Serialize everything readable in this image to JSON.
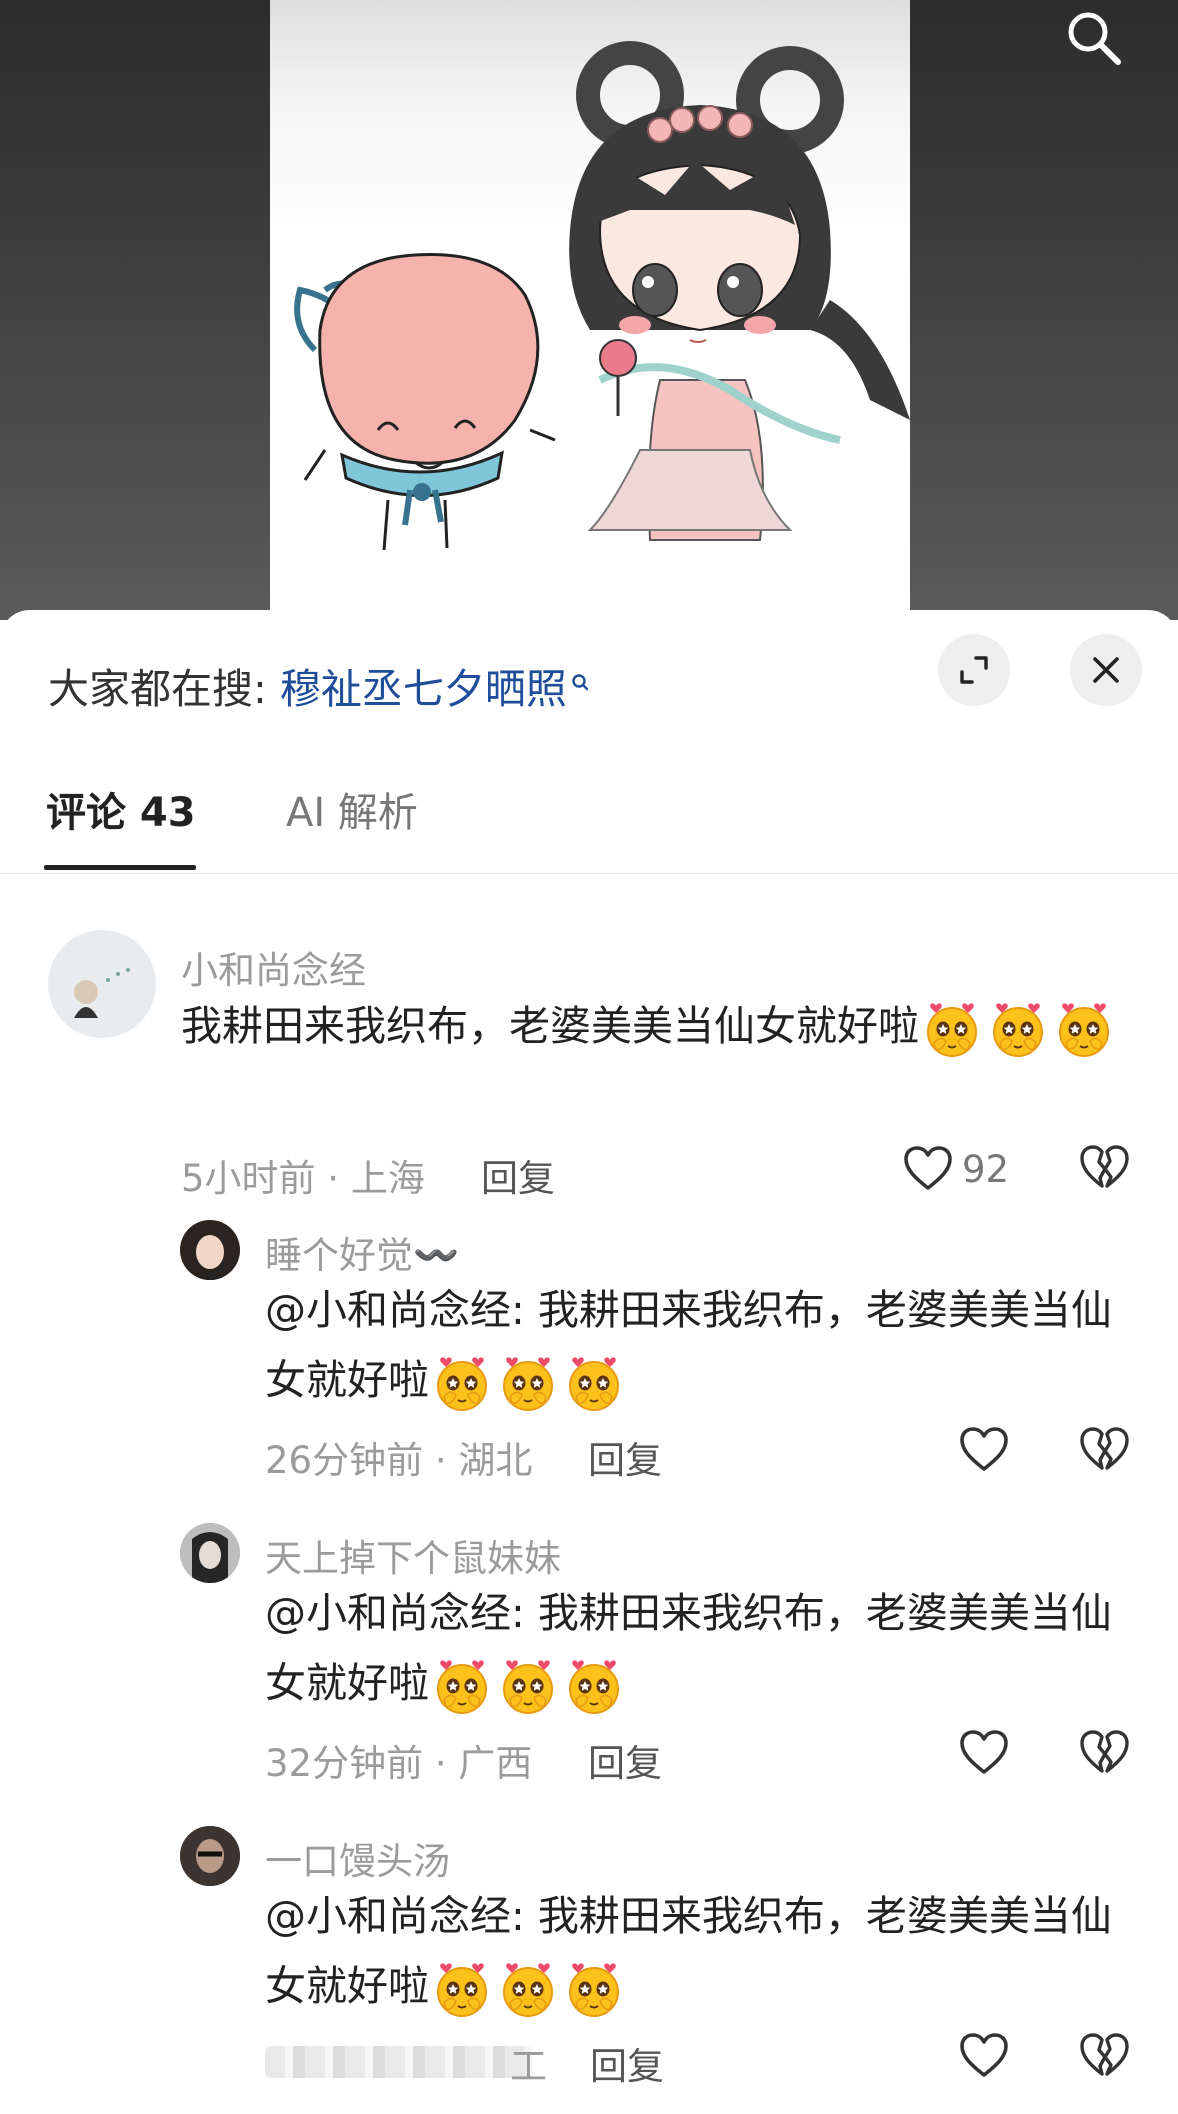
{
  "header": {
    "hot_search_label": "大家都在搜:",
    "hot_search_keyword": "穆祉丞七夕晒照"
  },
  "tabs": [
    {
      "label": "评论 43"
    },
    {
      "label": "AI 解析"
    }
  ],
  "colors": {
    "accent_link": "#1e4d9a",
    "primary_text": "#222222",
    "secondary_text": "#9b9b9b"
  },
  "icons": [
    "search-icon",
    "expand-icon",
    "close-icon",
    "heart-icon",
    "broken-heart-icon",
    "heart-eyes-emoji"
  ],
  "comments": [
    {
      "user": "小和尚念经",
      "text": "我耕田来我织布，老婆美美当仙女就好啦",
      "emoji_count": 3,
      "meta": "5小时前 · 上海",
      "reply_label": "回复",
      "likes": "92"
    },
    {
      "user": "睡个好觉〰️",
      "text": "@小和尚念经: 我耕田来我织布，老婆美美当仙女就好啦",
      "emoji_count": 3,
      "meta": "26分钟前 · 湖北",
      "reply_label": "回复"
    },
    {
      "user": "天上掉下个鼠妹妹",
      "text": "@小和尚念经: 我耕田来我织布，老婆美美当仙女就好啦",
      "emoji_count": 3,
      "meta": "32分钟前 · 广西",
      "reply_label": "回复"
    },
    {
      "user": "一口馒头汤",
      "text": "@小和尚念经: 我耕田来我织布，老婆美美当仙女就好啦",
      "emoji_count": 3,
      "meta": "工",
      "reply_label": "回复"
    }
  ]
}
